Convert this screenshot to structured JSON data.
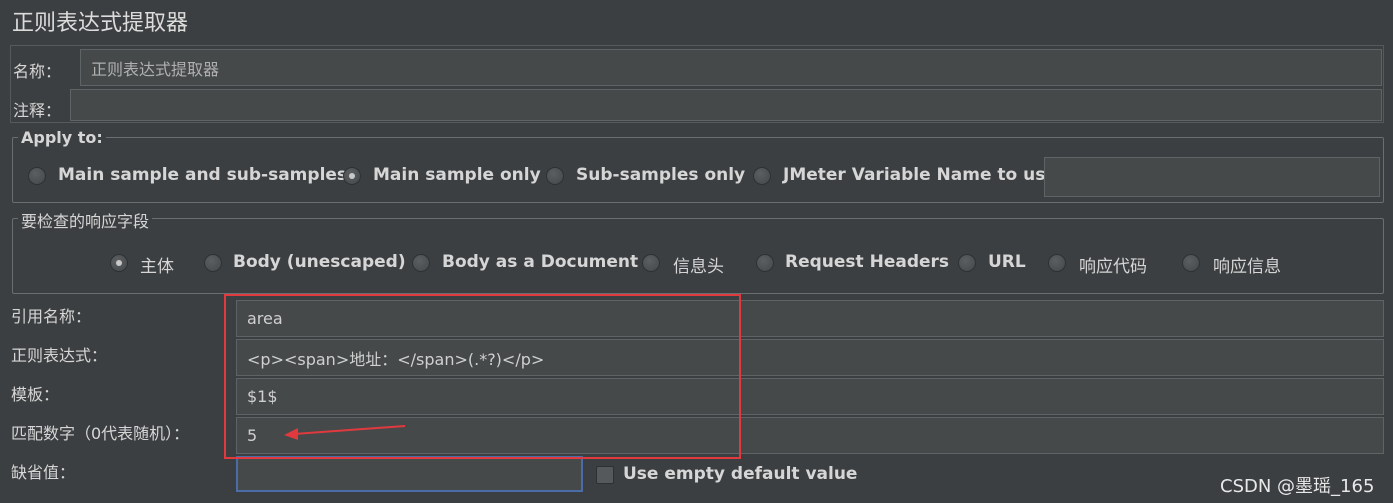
{
  "title": "正则表达式提取器",
  "name_label": "名称：",
  "name_value": "正则表达式提取器",
  "comment_label": "注释：",
  "comment_value": "",
  "apply_to": {
    "legend": "Apply to:",
    "options": [
      "Main sample and sub-samples",
      "Main sample only",
      "Sub-samples only",
      "JMeter Variable Name to use"
    ],
    "selected": "Main sample only",
    "variable_value": ""
  },
  "response_field": {
    "legend": "要检查的响应字段",
    "options": [
      "主体",
      "Body (unescaped)",
      "Body as a Document",
      "信息头",
      "Request Headers",
      "URL",
      "响应代码",
      "响应信息"
    ],
    "selected": "主体"
  },
  "form": {
    "ref_name_label": "引用名称：",
    "ref_name_value": "area",
    "regex_label": "正则表达式：",
    "regex_value": "<p><span>地址：</span>(.*?)</p>",
    "template_label": "模板：",
    "template_value": "$1$",
    "match_no_label": "匹配数字（0代表随机）：",
    "match_no_value": "5",
    "default_label": "缺省值：",
    "default_value": "",
    "use_empty_label": "Use empty default value"
  },
  "annotation_color": "#e0393e",
  "watermark": "CSDN @墨瑶_165"
}
